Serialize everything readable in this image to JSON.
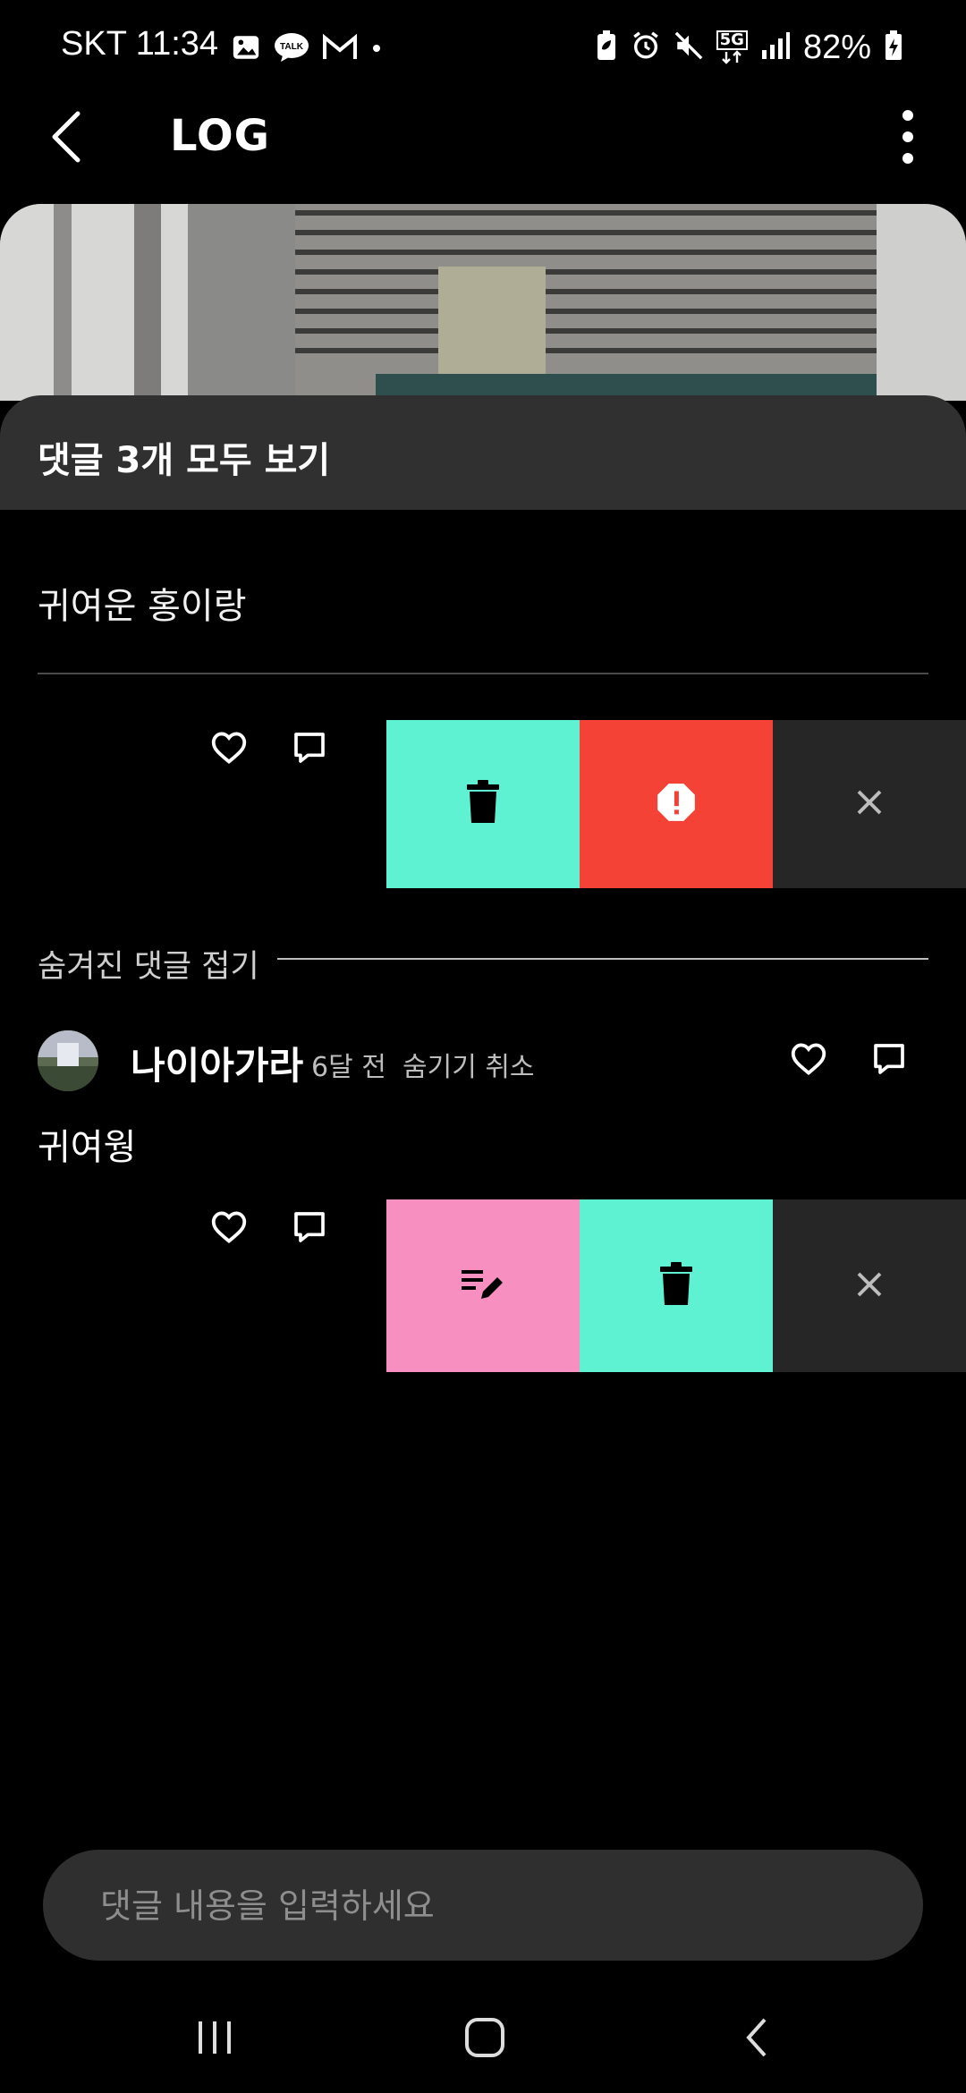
{
  "status_bar": {
    "carrier_time": "SKT 11:34",
    "battery": "82%",
    "network": "5G"
  },
  "app_bar": {
    "title": "LOG"
  },
  "comments_sheet": {
    "view_all": "댓글 3개 모두 보기",
    "first_comment": "귀여운 홍이랑",
    "hidden_section_label": "숨겨진 댓글 접기",
    "hidden_comment": {
      "username": "나이아가라",
      "time": "6달 전",
      "unhide": "숨기기 취소",
      "text": "귀여웡"
    }
  },
  "actions_row_1": {
    "colors": {
      "delete_bg": "#5EF2D2",
      "report_bg": "#F44336",
      "close_bg": "#262626"
    },
    "icons": [
      "trash-icon",
      "report-icon",
      "close-icon"
    ]
  },
  "actions_row_2": {
    "colors": {
      "edit_bg": "#F78FC1",
      "delete_bg": "#5EF2D2",
      "close_bg": "#262626"
    },
    "icons": [
      "edit-icon",
      "trash-icon",
      "close-icon"
    ]
  },
  "input": {
    "placeholder": "댓글 내용을 입력하세요"
  }
}
